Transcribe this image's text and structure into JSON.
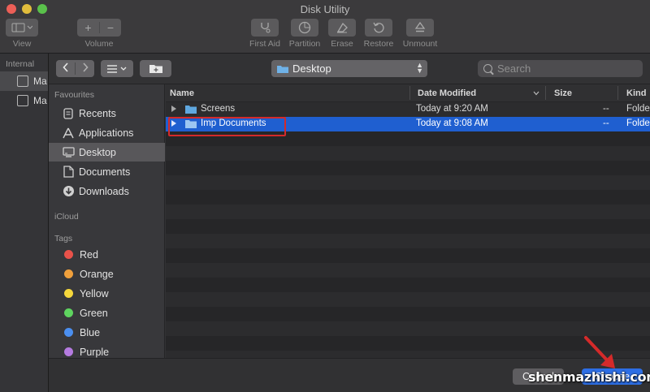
{
  "window": {
    "title": "Disk Utility"
  },
  "toolbar": {
    "view_label": "View",
    "volume_label": "Volume",
    "first_aid_label": "First Aid",
    "partition_label": "Partition",
    "erase_label": "Erase",
    "restore_label": "Restore",
    "unmount_label": "Unmount",
    "add_glyph": "+",
    "remove_glyph": "−"
  },
  "du_sidebar": {
    "header": "Internal",
    "items": [
      {
        "label": "Ma"
      },
      {
        "label": "Ma"
      }
    ]
  },
  "panel": {
    "location": "Desktop",
    "search_placeholder": "Search",
    "sidebar": {
      "favourites_header": "Favourites",
      "favourites": [
        {
          "label": "Recents",
          "icon": "recents-icon"
        },
        {
          "label": "Applications",
          "icon": "applications-icon"
        },
        {
          "label": "Desktop",
          "icon": "desktop-icon",
          "selected": true
        },
        {
          "label": "Documents",
          "icon": "documents-icon"
        },
        {
          "label": "Downloads",
          "icon": "downloads-icon"
        }
      ],
      "icloud_header": "iCloud",
      "tags_header": "Tags",
      "tags": [
        {
          "label": "Red",
          "color": "#e9524a"
        },
        {
          "label": "Orange",
          "color": "#f0a03c"
        },
        {
          "label": "Yellow",
          "color": "#f5d73c"
        },
        {
          "label": "Green",
          "color": "#5ed45f"
        },
        {
          "label": "Blue",
          "color": "#4b8ff0"
        },
        {
          "label": "Purple",
          "color": "#b57be0"
        }
      ]
    },
    "columns": {
      "name": "Name",
      "date_modified": "Date Modified",
      "size": "Size",
      "kind": "Kind"
    },
    "files": [
      {
        "name": "Screens",
        "date": "Today at 9:20 AM",
        "size": "--",
        "kind": "Folder"
      },
      {
        "name": "Imp Documents",
        "date": "Today at 9:08 AM",
        "size": "--",
        "kind": "Folder",
        "selected": true
      }
    ],
    "buttons": {
      "cancel": "Cancel",
      "choose": "Choose"
    }
  },
  "watermark": "shenmazhishi.com",
  "accent_colors": {
    "selection": "#1f5fd0",
    "annotation": "#d42a2a"
  }
}
